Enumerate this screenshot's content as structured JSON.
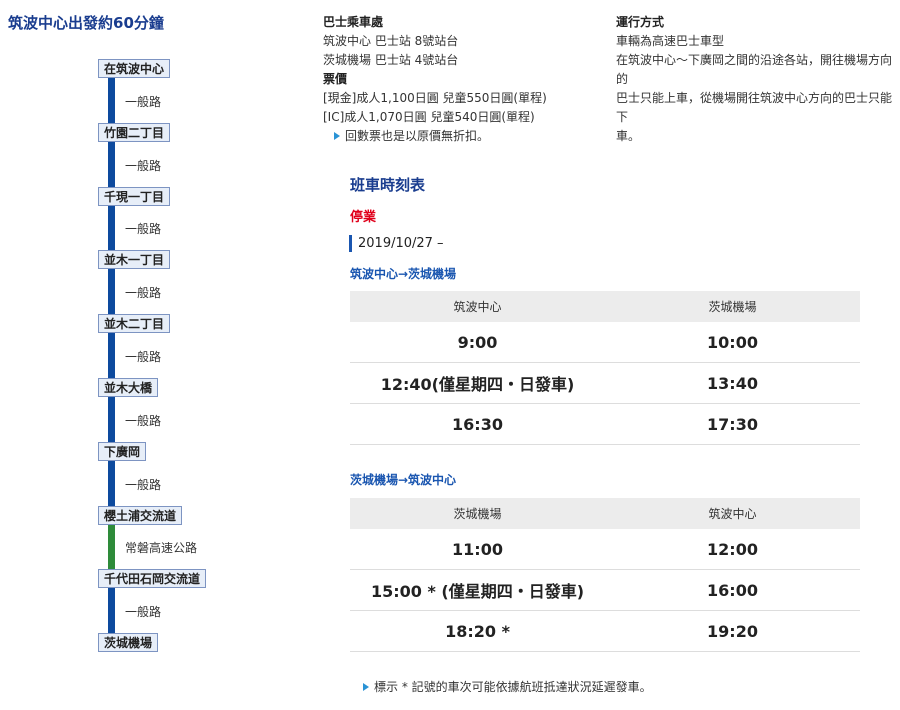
{
  "title": "筑波中心出發約60分鐘",
  "route": {
    "stops": [
      "在筑波中心",
      "竹園二丁目",
      "千現一丁目",
      "並木一丁目",
      "並木二丁目",
      "並木大橋",
      "下廣岡",
      "櫻土浦交流道",
      "千代田石岡交流道",
      "茨城機場"
    ],
    "segments": [
      {
        "label": "一般路",
        "type": "local"
      },
      {
        "label": "一般路",
        "type": "local"
      },
      {
        "label": "一般路",
        "type": "local"
      },
      {
        "label": "一般路",
        "type": "local"
      },
      {
        "label": "一般路",
        "type": "local"
      },
      {
        "label": "一般路",
        "type": "local"
      },
      {
        "label": "一般路",
        "type": "local"
      },
      {
        "label": "常磐高速公路",
        "type": "highway"
      },
      {
        "label": "一般路",
        "type": "local"
      }
    ],
    "colors": {
      "local": "#0d4a9e",
      "highway": "#2e8b3a"
    }
  },
  "boarding": {
    "heading": "巴士乘車處",
    "lines": [
      "筑波中心 巴士站 8號站台",
      "茨城機場 巴士站 4號站台"
    ]
  },
  "fare": {
    "heading": "票價",
    "lines": [
      "[現金]成人1,100日圓 兒童550日圓(單程)",
      "[IC]成人1,070日圓 兒童540日圓(單程)"
    ],
    "note": "回數票也是以原價無折扣。"
  },
  "operation": {
    "heading": "運行方式",
    "lines": [
      "車輛為高速巴士車型",
      "在筑波中心〜下廣岡之間的沿途各站，開往機場方向的",
      "巴士只能上車，從機場開往筑波中心方向的巴士只能下",
      "車。"
    ]
  },
  "timetable": {
    "title": "班車時刻表",
    "status": "停業",
    "date": "2019/10/27 –",
    "directions": [
      {
        "label": "筑波中心→茨城機場",
        "headers": [
          "筑波中心",
          "茨城機場"
        ],
        "rows": [
          [
            "9:00",
            "10:00"
          ],
          [
            "12:40(僅星期四・日發車)",
            "13:40"
          ],
          [
            "16:30",
            "17:30"
          ]
        ]
      },
      {
        "label": "茨城機場→筑波中心",
        "headers": [
          "茨城機場",
          "筑波中心"
        ],
        "rows": [
          [
            "11:00",
            "12:00"
          ],
          [
            "15:00 * (僅星期四・日發車)",
            "16:00"
          ],
          [
            "18:20 *",
            "19:20"
          ]
        ]
      }
    ],
    "footnote": "標示 * 記號的車次可能依據航班抵達狀況延遲發車。"
  }
}
